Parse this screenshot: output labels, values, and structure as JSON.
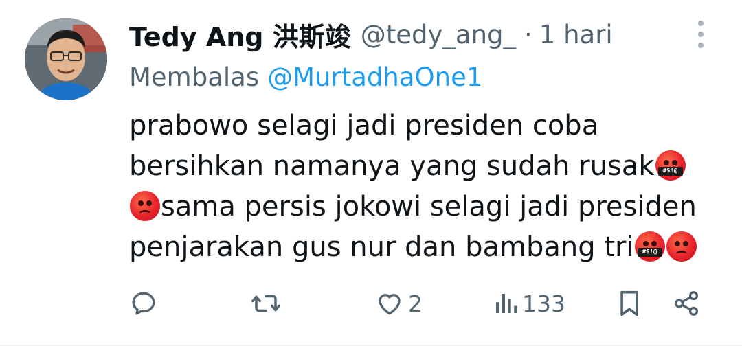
{
  "tweet": {
    "author_name": "Tedy Ang 洪斯竣",
    "author_handle": "@tedy_ang_",
    "separator": "·",
    "timestamp": "1 hari",
    "reply_prefix": "Membalas",
    "reply_to": "@MurtadhaOne1",
    "body_lines": {
      "l1": "prabowo selagi jadi presiden coba",
      "l2": "bersihkan namanya yang sudah rusak",
      "l3": "sama persis jokowi selagi jadi presiden",
      "l4": "penjarakan gus nur dan bambang tri"
    },
    "emoji": {
      "cursing_symbols": "#$!@",
      "angry": "angry-face-icon",
      "cursing": "cursing-face-icon"
    }
  },
  "actions": {
    "reply_icon": "reply-icon",
    "retweet_icon": "retweet-icon",
    "like_icon": "heart-icon",
    "like_count": "2",
    "views_icon": "views-bar-icon",
    "views_count": "133",
    "bookmark_icon": "bookmark-icon",
    "share_icon": "share-icon"
  },
  "colors": {
    "text_primary": "#0f1419",
    "text_secondary": "#536471",
    "link": "#1d9bf0",
    "emoji_red": "#e8232c"
  }
}
